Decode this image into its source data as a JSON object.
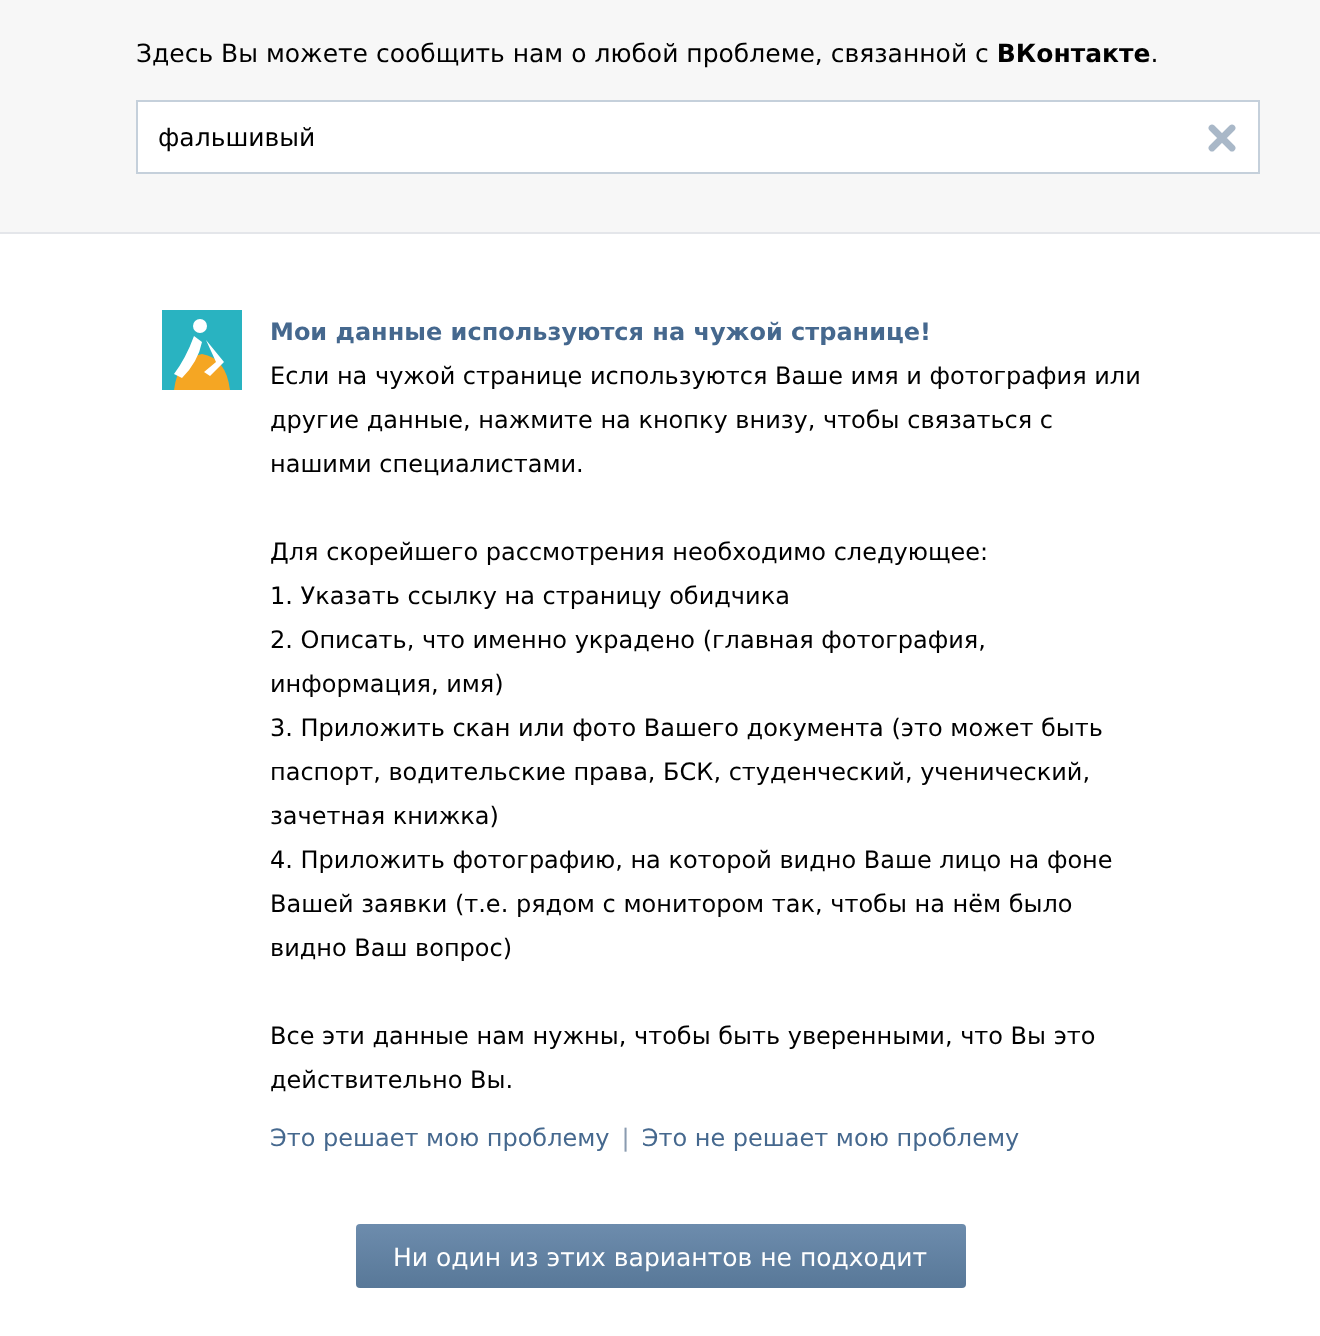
{
  "intro": "Здесь Вы можете сообщить нам о любой проблеме, связанной с **ВКонтакте**.",
  "search": {
    "value": "фальшивый"
  },
  "answer": {
    "title": "Мои данные используются на чужой странице!",
    "description": "Если на чужой странице используются Ваше имя и фотография или другие данные, нажмите на кнопку внизу, чтобы связаться с нашими специалистами.",
    "requirements_heading": "Для скорейшего рассмотрения необходимо следующее:",
    "requirements": [
      "1. Указать ссылку на страницу обидчика",
      "2. Описать, что именно украдено (главная фотография, информация, имя)",
      "3. Приложить скан или фото Вашего документа (это может быть паспорт, водительские права, БСК, студенческий, ученический, зачетная книжка)",
      "4. Приложить фотографию, на которой видно Ваше лицо на фоне Вашей заявки (т.е. рядом с монитором так, чтобы на нём было видно Ваш вопрос)"
    ],
    "closing": "Все эти данные нам нужны, чтобы быть уверенными, что Вы это действительно Вы.",
    "links": [
      "Это решает мою проблему",
      "Это не решает мою проблему"
    ],
    "separator": "|"
  },
  "button": "Ни один из этих вариантов не подходит"
}
